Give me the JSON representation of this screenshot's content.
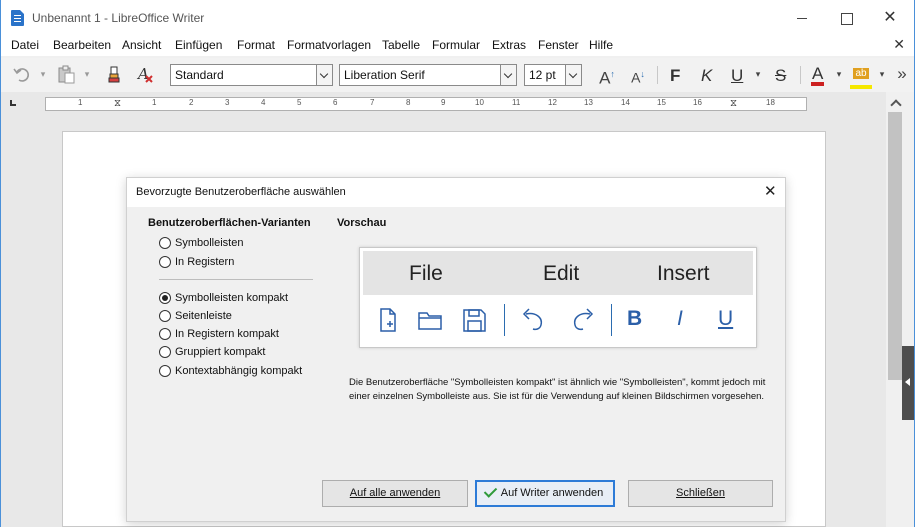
{
  "window": {
    "title": "Unbenannt 1 - LibreOffice Writer",
    "minimize_label": "—",
    "maximize_label": "☐",
    "close_label": "✕"
  },
  "menubar": {
    "items": [
      "Datei",
      "Bearbeiten",
      "Ansicht",
      "Einfügen",
      "Format",
      "Formatvorlagen",
      "Tabelle",
      "Formular",
      "Extras",
      "Fenster",
      "Hilfe"
    ],
    "close_label": "✕"
  },
  "toolbar": {
    "paragraph_style": "Standard",
    "font_name": "Liberation Serif",
    "font_size": "12 pt",
    "grow_font_label": "A",
    "shrink_font_label": "A",
    "bold_label": "F",
    "italic_label": "K",
    "underline_label": "U",
    "strikethrough_label": "S",
    "font_color_label": "A",
    "font_color": "#cc2020",
    "highlight_label": "ab",
    "highlight_color": "#f5e800",
    "overflow_label": "»"
  },
  "ruler": {
    "numbers": [
      "1",
      "1",
      "2",
      "3",
      "4",
      "5",
      "6",
      "7",
      "8",
      "9",
      "10",
      "11",
      "12",
      "13",
      "14",
      "15",
      "16",
      "17",
      "18"
    ]
  },
  "dialog": {
    "title": "Bevorzugte Benutzeroberfläche auswählen",
    "close_label": "✕",
    "variants_heading": "Benutzeroberflächen-Varianten",
    "preview_heading": "Vorschau",
    "variants": [
      {
        "label": "Symbolleisten",
        "checked": false
      },
      {
        "label": "In Registern",
        "checked": false
      },
      {
        "label": "Symbolleisten kompakt",
        "checked": true
      },
      {
        "label": "Seitenleiste",
        "checked": false
      },
      {
        "label": "In Registern kompakt",
        "checked": false
      },
      {
        "label": "Gruppiert kompakt",
        "checked": false
      },
      {
        "label": "Kontextabhängig kompakt",
        "checked": false
      }
    ],
    "preview": {
      "menu_items": [
        "File",
        "Edit",
        "Insert"
      ],
      "bold_label": "B",
      "italic_label": "I",
      "underline_label": "U",
      "accent_color": "#2b5fa8"
    },
    "description": "Die Benutzeroberfläche \"Symbolleisten kompakt\" ist ähnlich wie \"Symbolleisten\", kommt jedoch mit einer einzelnen Symbolleiste aus. Sie ist für die Verwendung auf kleinen Bildschirmen vorgesehen.",
    "buttons": {
      "apply_all": "Auf alle anwenden",
      "apply_writer": "Auf Writer anwenden",
      "close": "Schließen"
    }
  }
}
